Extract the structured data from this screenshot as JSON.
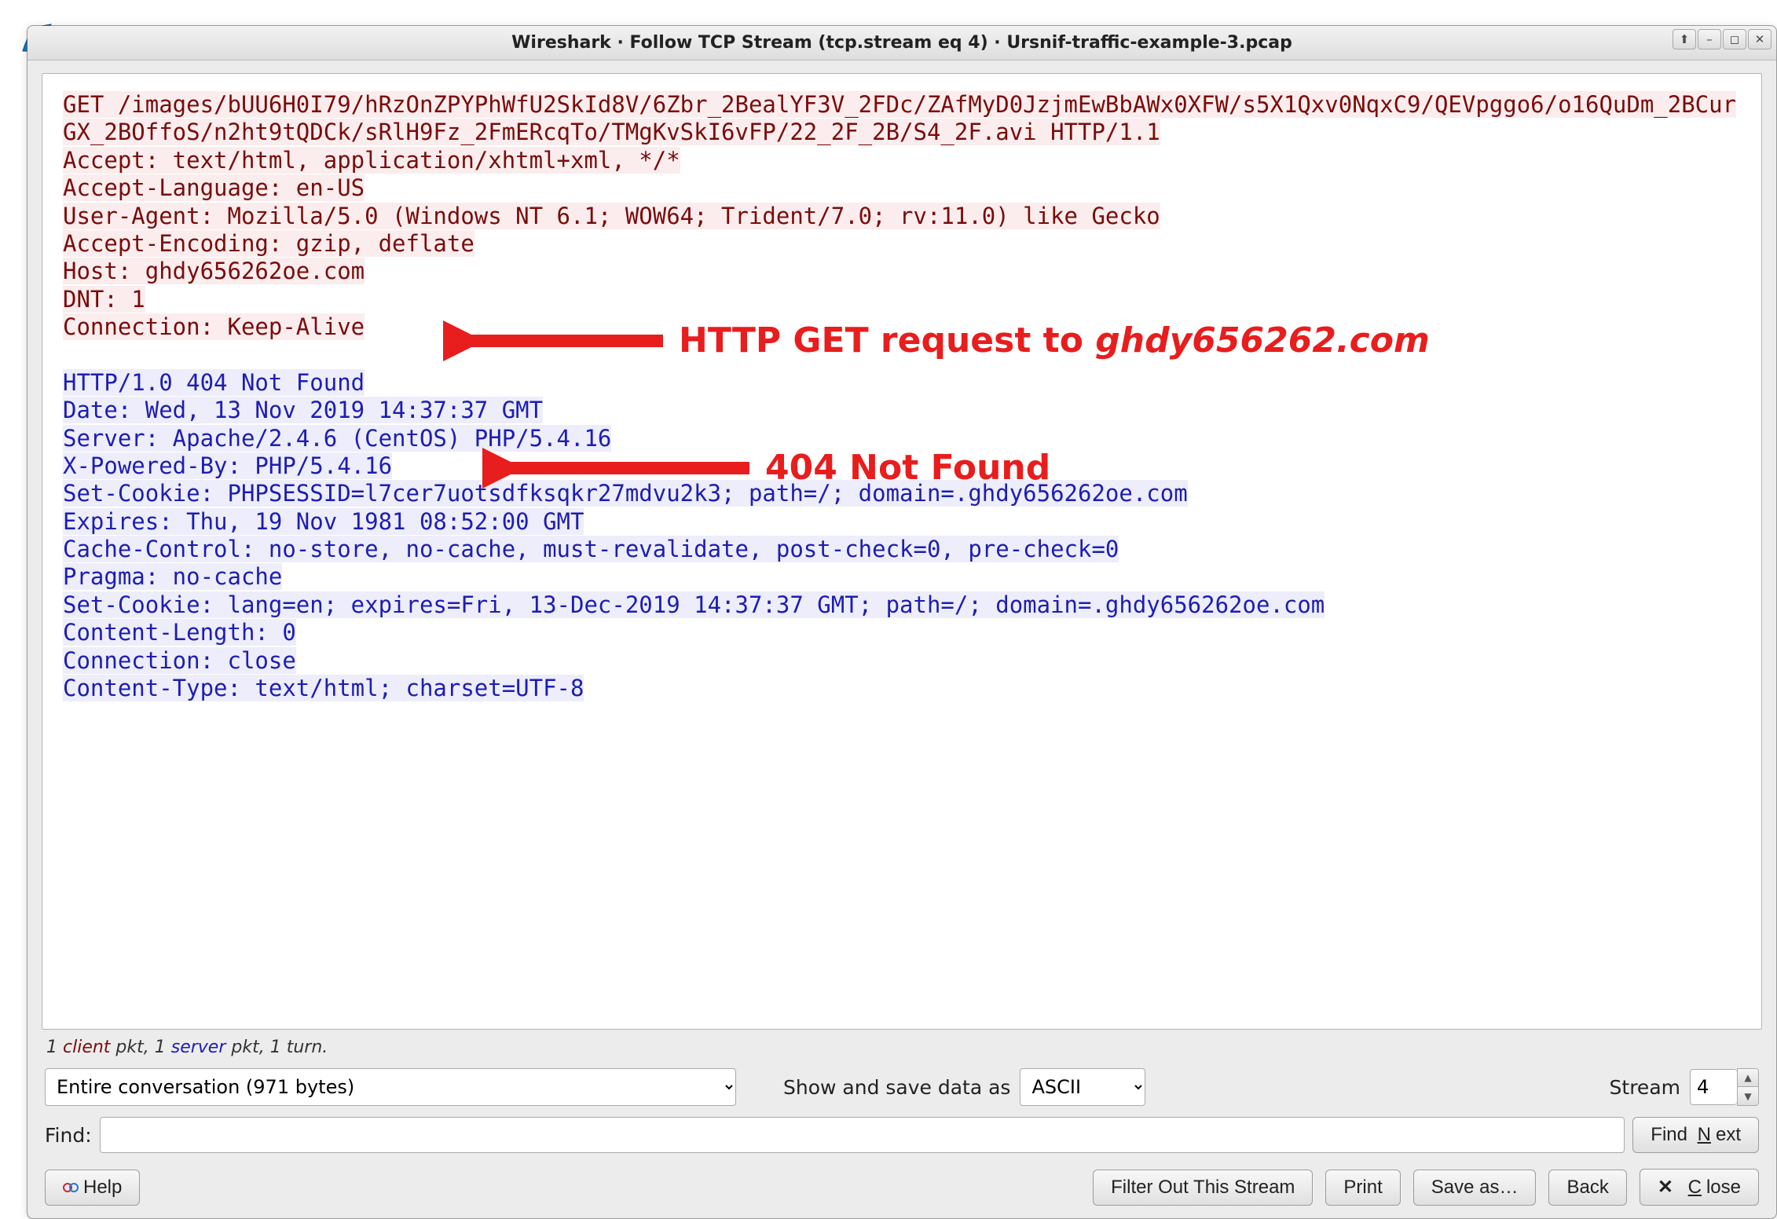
{
  "window": {
    "title": "Wireshark · Follow TCP Stream (tcp.stream eq 4) · Ursnif-traffic-example-3.pcap",
    "controls": {
      "up": "⤒",
      "min": "—",
      "max": "▢",
      "close": "✕"
    }
  },
  "stream": {
    "request": "GET /images/bUU6H0I79/hRzOnZPYPhWfU2SkId8V/6Zbr_2BealYF3V_2FDc/ZAfMyD0JzjmEwBbAWx0XFW/s5X1Qxv0NqxC9/QEVpggo6/o16QuDm_2BCurGX_2BOffoS/n2ht9tQDCk/sRlH9Fz_2FmERcqTo/TMgKvSkI6vFP/22_2F_2B/S4_2F.avi HTTP/1.1\nAccept: text/html, application/xhtml+xml, */*\nAccept-Language: en-US\nUser-Agent: Mozilla/5.0 (Windows NT 6.1; WOW64; Trident/7.0; rv:11.0) like Gecko\nAccept-Encoding: gzip, deflate\nHost: ghdy656262oe.com\nDNT: 1\nConnection: Keep-Alive\n",
    "response": "HTTP/1.0 404 Not Found\nDate: Wed, 13 Nov 2019 14:37:37 GMT\nServer: Apache/2.4.6 (CentOS) PHP/5.4.16\nX-Powered-By: PHP/5.4.16\nSet-Cookie: PHPSESSID=l7cer7uotsdfksqkr27mdvu2k3; path=/; domain=.ghdy656262oe.com\nExpires: Thu, 19 Nov 1981 08:52:00 GMT\nCache-Control: no-store, no-cache, must-revalidate, post-check=0, pre-check=0\nPragma: no-cache\nSet-Cookie: lang=en; expires=Fri, 13-Dec-2019 14:37:37 GMT; path=/; domain=.ghdy656262oe.com\nContent-Length: 0\nConnection: close\nContent-Type: text/html; charset=UTF-8"
  },
  "stats": {
    "client_count": "1",
    "client_word": "client",
    "server_count": "1",
    "server_word": "server",
    "suffix": "pkt, 1 turn."
  },
  "controls": {
    "conversation_select": "Entire conversation (971 bytes)",
    "show_as_label": "Show and save data as",
    "format_select": "ASCII",
    "stream_label": "Stream",
    "stream_value": "4"
  },
  "find": {
    "label": "Find:",
    "value": "",
    "button": "Find Next",
    "button_ul": "N"
  },
  "buttons": {
    "help": "Help",
    "filter_out": "Filter Out This Stream",
    "print": "Print",
    "save_as": "Save as…",
    "back": "Back",
    "close": "Close",
    "close_ul": "C"
  },
  "annotations": {
    "a1_prefix": "HTTP GET request to ",
    "a1_domain": "ghdy656262.com",
    "a2": "404 Not Found"
  }
}
